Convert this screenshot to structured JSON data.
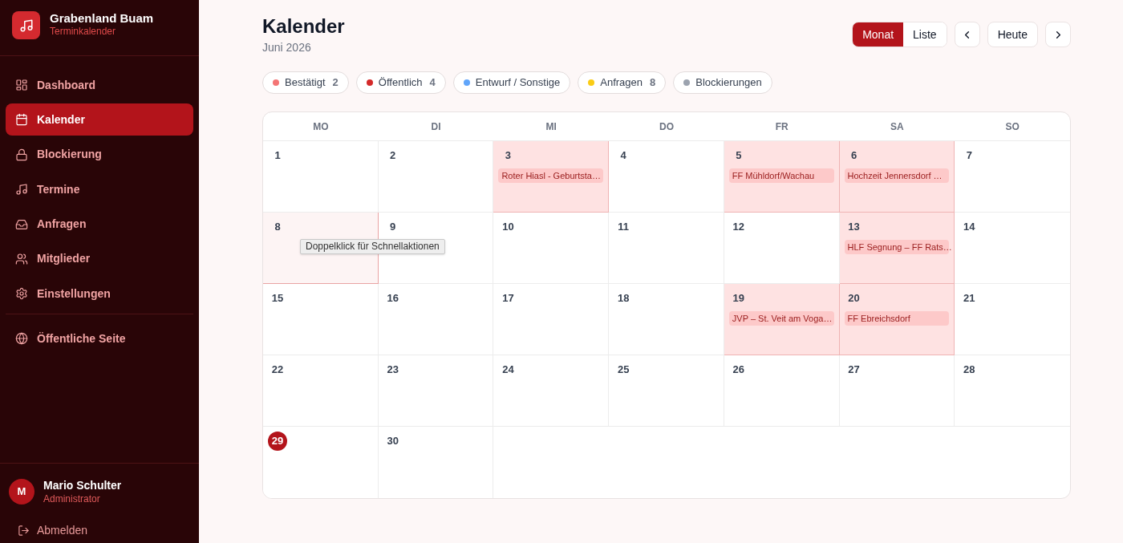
{
  "sidebar": {
    "brand": {
      "title": "Grabenland Buam",
      "subtitle": "Terminkalender"
    },
    "nav": [
      {
        "label": "Dashboard",
        "selected": false
      },
      {
        "label": "Kalender",
        "selected": true
      },
      {
        "label": "Blockierung",
        "selected": false
      },
      {
        "label": "Termine",
        "selected": false
      },
      {
        "label": "Anfragen",
        "selected": false
      },
      {
        "label": "Mitglieder",
        "selected": false
      },
      {
        "label": "Einstellungen",
        "selected": false
      }
    ],
    "secondary_nav": [
      {
        "label": "Öffentliche Seite",
        "selected": false
      }
    ],
    "user": {
      "initial": "M",
      "name": "Mario Schulter",
      "role": "Administrator"
    },
    "logout": "Abmelden"
  },
  "header": {
    "title": "Kalender",
    "subtitle": "Juni 2026",
    "view_modes": [
      {
        "label": "Monat",
        "selected": true
      },
      {
        "label": "Liste",
        "selected": false
      }
    ],
    "today_button": "Heute"
  },
  "legend": [
    {
      "label": "Bestätigt",
      "count": "2",
      "color": "#f47575"
    },
    {
      "label": "Öffentlich",
      "count": "4",
      "color": "#d42a2a"
    },
    {
      "label": "Entwurf / Sonstige",
      "color": "#60a5fa"
    },
    {
      "label": "Anfragen",
      "count": "8",
      "color": "#facc15"
    },
    {
      "label": "Blockierungen",
      "color": "#9ca3af"
    }
  ],
  "calendar": {
    "weekdays": [
      "MO",
      "DI",
      "MI",
      "DO",
      "FR",
      "SA",
      "SO"
    ],
    "weeks": [
      [
        {
          "day": "1",
          "today": false,
          "hovered": false
        },
        {
          "day": "2",
          "today": false,
          "hovered": false
        },
        {
          "day": "3",
          "today": false,
          "hovered": false,
          "events": [
            "Roter Hiasl - Geburtsta…"
          ]
        },
        {
          "day": "4",
          "today": false,
          "hovered": false
        },
        {
          "day": "5",
          "today": false,
          "hovered": false,
          "events": [
            "FF Mühldorf/Wachau"
          ]
        },
        {
          "day": "6",
          "today": false,
          "hovered": false,
          "events": [
            "Hochzeit Jennersdorf …"
          ]
        },
        {
          "day": "7",
          "today": false,
          "hovered": false
        }
      ],
      [
        {
          "day": "8",
          "today": false,
          "hovered": true,
          "tooltip": "Doppelklick für Schnellaktionen"
        },
        {
          "day": "9",
          "today": false,
          "hovered": false
        },
        {
          "day": "10",
          "today": false,
          "hovered": false
        },
        {
          "day": "11",
          "today": false,
          "hovered": false
        },
        {
          "day": "12",
          "today": false,
          "hovered": false
        },
        {
          "day": "13",
          "today": false,
          "hovered": false,
          "events": [
            "HLF Segnung – FF Rats…"
          ]
        },
        {
          "day": "14",
          "today": false,
          "hovered": false
        }
      ],
      [
        {
          "day": "15",
          "today": false,
          "hovered": false
        },
        {
          "day": "16",
          "today": false,
          "hovered": false
        },
        {
          "day": "17",
          "today": false,
          "hovered": false
        },
        {
          "day": "18",
          "today": false,
          "hovered": false
        },
        {
          "day": "19",
          "today": false,
          "hovered": false,
          "events": [
            "JVP – St. Veit am Voga…"
          ]
        },
        {
          "day": "20",
          "today": false,
          "hovered": false,
          "events": [
            "FF Ebreichsdorf"
          ]
        },
        {
          "day": "21",
          "today": false,
          "hovered": false
        }
      ],
      [
        {
          "day": "22",
          "today": false,
          "hovered": false
        },
        {
          "day": "23",
          "today": false,
          "hovered": false
        },
        {
          "day": "24",
          "today": false,
          "hovered": false
        },
        {
          "day": "25",
          "today": false,
          "hovered": false
        },
        {
          "day": "26",
          "today": false,
          "hovered": false
        },
        {
          "day": "27",
          "today": false,
          "hovered": false
        },
        {
          "day": "28",
          "today": false,
          "hovered": false
        }
      ],
      [
        {
          "day": "29",
          "today": true,
          "hovered": false
        },
        {
          "day": "30",
          "today": false,
          "hovered": false
        }
      ]
    ]
  }
}
